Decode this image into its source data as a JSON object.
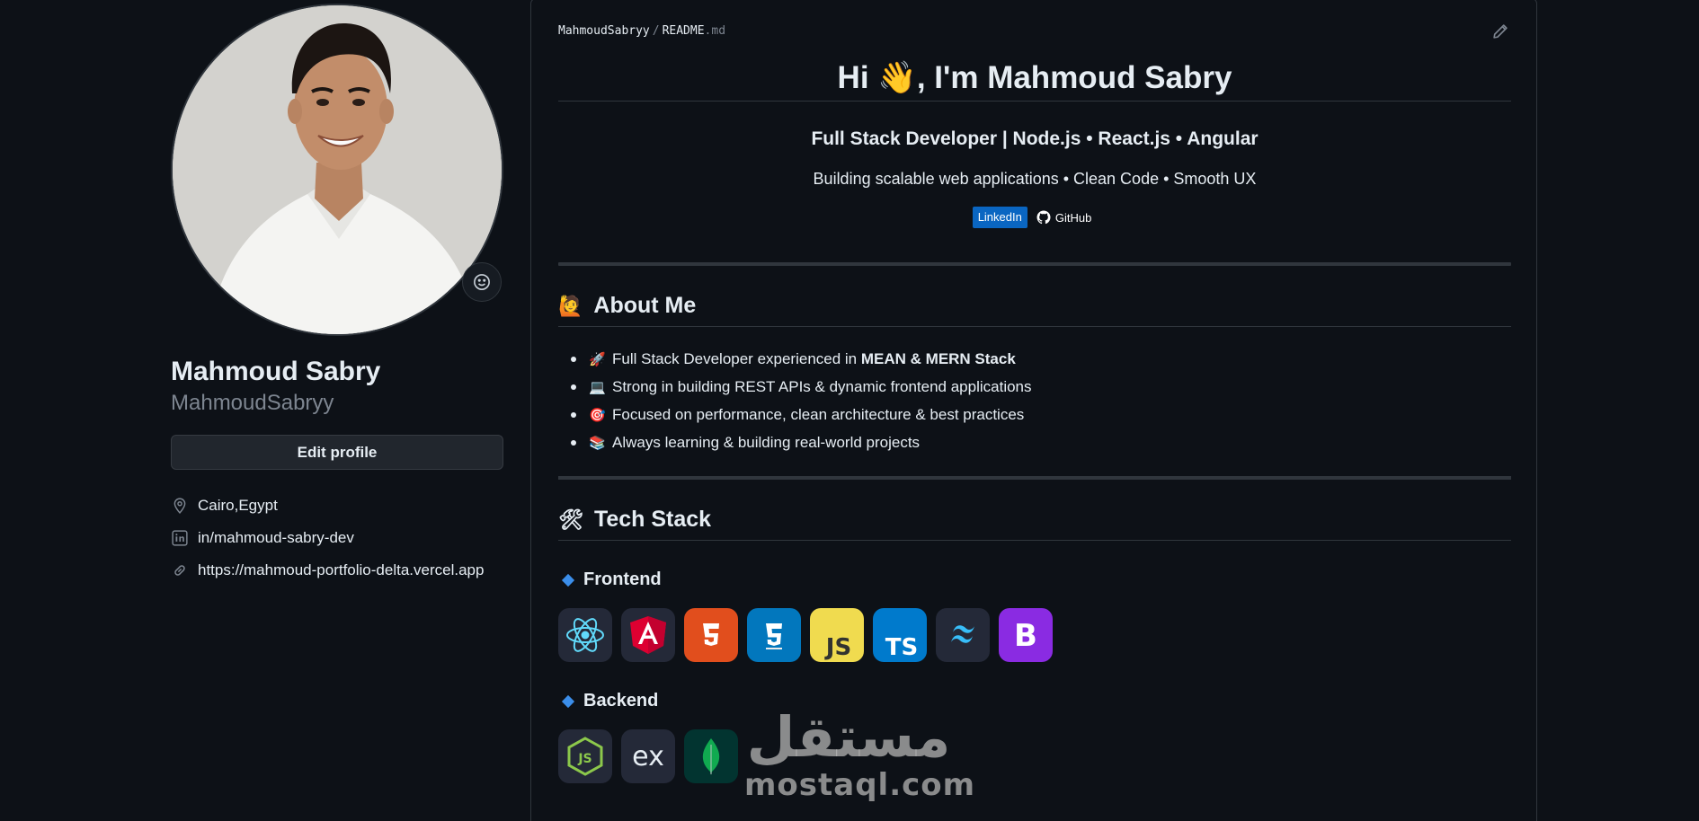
{
  "profile": {
    "full_name": "Mahmoud Sabry",
    "login": "MahmoudSabryy",
    "edit_label": "Edit profile",
    "meta": [
      {
        "icon": "location-icon",
        "text": "Cairo,Egypt"
      },
      {
        "icon": "linkedin-icon",
        "text": "in/mahmoud-sabry-dev"
      },
      {
        "icon": "link-icon",
        "text": "https://mahmoud-portfolio-delta.vercel.app"
      }
    ]
  },
  "readme": {
    "breadcrumb": {
      "owner": "MahmoudSabryy",
      "sep": "/",
      "file": "README",
      "ext": ".md"
    },
    "title": "Hi 👋, I'm Mahmoud Sabry",
    "headline": "Full Stack Developer | Node.js • React.js • Angular",
    "tagline": "Building scalable web applications • Clean Code • Smooth UX",
    "badges": {
      "linkedin": "LinkedIn",
      "github": "GitHub"
    },
    "about": {
      "heading": "About Me",
      "heading_emoji": "🙋",
      "items": [
        {
          "emoji": "🚀",
          "text": "Full Stack Developer experienced in ",
          "bold": "MEAN & MERN Stack"
        },
        {
          "emoji": "💻",
          "text": "Strong in building REST APIs & dynamic frontend applications",
          "bold": ""
        },
        {
          "emoji": "🎯",
          "text": "Focused on performance, clean architecture & best practices",
          "bold": ""
        },
        {
          "emoji": "📚",
          "text": "Always learning & building real-world projects",
          "bold": ""
        }
      ]
    },
    "tech": {
      "heading": "Tech Stack",
      "heading_emoji": "🛠",
      "frontend_label": "Frontend",
      "frontend": [
        "React",
        "Angular",
        "HTML5",
        "CSS3",
        "JavaScript",
        "TypeScript",
        "Tailwind",
        "Bootstrap"
      ],
      "backend_label": "Backend",
      "backend": [
        "Node.js",
        "Express",
        "MongoDB"
      ]
    }
  },
  "watermark": {
    "arabic": "مستقل",
    "latin": "mostaql.com"
  },
  "colors": {
    "bg": "#0d1117",
    "border": "#30363d",
    "muted": "#7d8590",
    "linkedin": "#0a66c2",
    "accent": "#3b8eea"
  }
}
